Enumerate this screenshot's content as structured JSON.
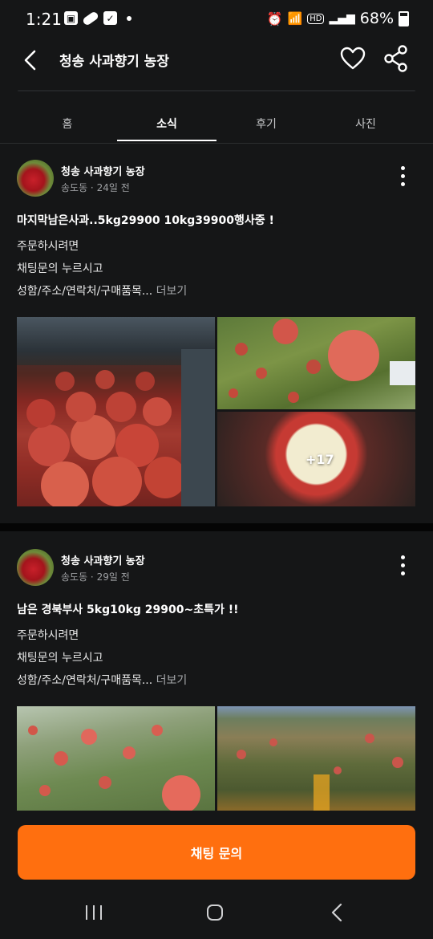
{
  "status_bar": {
    "time": "1:21",
    "battery": "68%",
    "icons": [
      "gallery-icon",
      "pill-icon",
      "checkbox-icon",
      "alarm-icon",
      "wifi-icon",
      "hd-icon",
      "signal-icon",
      "battery-icon"
    ]
  },
  "header": {
    "title": "청송 사과향기 농장",
    "icons": [
      "back-icon",
      "heart-icon",
      "share-icon"
    ]
  },
  "tabs": [
    {
      "label": "홈",
      "active": false
    },
    {
      "label": "소식",
      "active": true
    },
    {
      "label": "후기",
      "active": false
    },
    {
      "label": "사진",
      "active": false
    }
  ],
  "posts": [
    {
      "author": "청송 사과향기 농장",
      "location": "송도동",
      "time": "24일 전",
      "meta": "송도동 · 24일 전",
      "title": "마지막남은사과..5kg29900 10kg39900행사중 !",
      "lines": [
        "주문하시려면",
        "채팅문의 누르시고",
        "성함/주소/연락처/구매품목..."
      ],
      "more_label": "더보기",
      "extra_photos": "+17"
    },
    {
      "author": "청송 사과향기 농장",
      "location": "송도동",
      "time": "29일 전",
      "meta": "송도동 · 29일 전",
      "title": "남은 경북부사 5kg10kg 29900~초특가 !!",
      "lines": [
        "주문하시려면",
        "채팅문의 누르시고",
        "성함/주소/연락처/구매품목..."
      ],
      "more_label": "더보기"
    }
  ],
  "chat_button": {
    "label": "채팅 문의",
    "color": "#ff6f0f"
  },
  "theme": {
    "background": "#151617",
    "accent": "#ff6f0f"
  },
  "nav_bar": [
    "recent-apps-icon",
    "home-icon",
    "back-icon"
  ]
}
